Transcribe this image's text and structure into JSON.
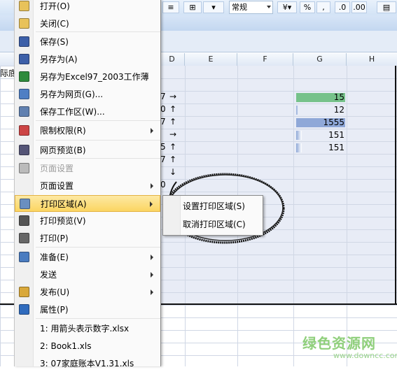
{
  "ribbon": {
    "number_format": "常规",
    "percent_symbol": "%",
    "comma_symbol": ","
  },
  "partial_cell_text": "际底",
  "columns": [
    "D",
    "E",
    "F",
    "G",
    "H"
  ],
  "data_rows": [
    {
      "value": "15",
      "fraction": 1.0,
      "color": "#76c28a"
    },
    {
      "value": "12",
      "fraction": 0.05,
      "color": "#8fa8d8"
    },
    {
      "value": "1555",
      "fraction": 1.0,
      "color": "#8fa8d8"
    },
    {
      "value": "151",
      "fraction": 0.12,
      "color": "#8fa8d8"
    },
    {
      "value": "151",
      "fraction": 0.12,
      "color": "#8fa8d8"
    }
  ],
  "d_column_fragments": [
    "7",
    "0",
    "7",
    "",
    "5",
    "7",
    "",
    "0"
  ],
  "d_column_arrows": [
    "→",
    "↑",
    "↑",
    "→",
    "↑",
    "↑",
    "↓",
    ""
  ],
  "menu": {
    "items": [
      {
        "label": "打开(O)",
        "icon": "folder-open-icon"
      },
      {
        "label": "关闭(C)",
        "icon": "folder-icon"
      },
      {
        "label": "保存(S)",
        "icon": "save-icon"
      },
      {
        "label": "另存为(A)",
        "icon": "save-as-icon"
      },
      {
        "label": "另存为Excel97_2003工作薄",
        "icon": "excel-icon"
      },
      {
        "label": "另存为网页(G)...",
        "icon": "web-save-icon"
      },
      {
        "label": "保存工作区(W)...",
        "icon": "workspace-icon"
      },
      {
        "label": "限制权限(R)",
        "icon": "permission-icon"
      },
      {
        "label": "网页预览(B)",
        "icon": "web-preview-icon"
      },
      {
        "label": "页面设置",
        "icon": "page-setup-disabled-icon"
      },
      {
        "label": "页面设置",
        "icon": ""
      },
      {
        "label": "打印区域(A)",
        "icon": "print-area-icon"
      },
      {
        "label": "打印预览(V)",
        "icon": "print-preview-icon"
      },
      {
        "label": "打印(P)",
        "icon": "printer-icon"
      },
      {
        "label": "准备(E)",
        "icon": "prepare-icon"
      },
      {
        "label": "发送",
        "icon": ""
      },
      {
        "label": "发布(U)",
        "icon": "publish-icon"
      },
      {
        "label": "属性(P)",
        "icon": "properties-icon"
      },
      {
        "label": "1: 用箭头表示数字.xlsx",
        "icon": ""
      },
      {
        "label": "2: Book1.xls",
        "icon": ""
      },
      {
        "label": "3: 07家庭账本V1.31.xls",
        "icon": ""
      }
    ]
  },
  "submenu": {
    "set_print_area": "设置打印区域(S)",
    "cancel_print_area": "取消打印区域(C)"
  },
  "watermark": {
    "title": "绿色资源网",
    "url": "www.downcc.com"
  }
}
